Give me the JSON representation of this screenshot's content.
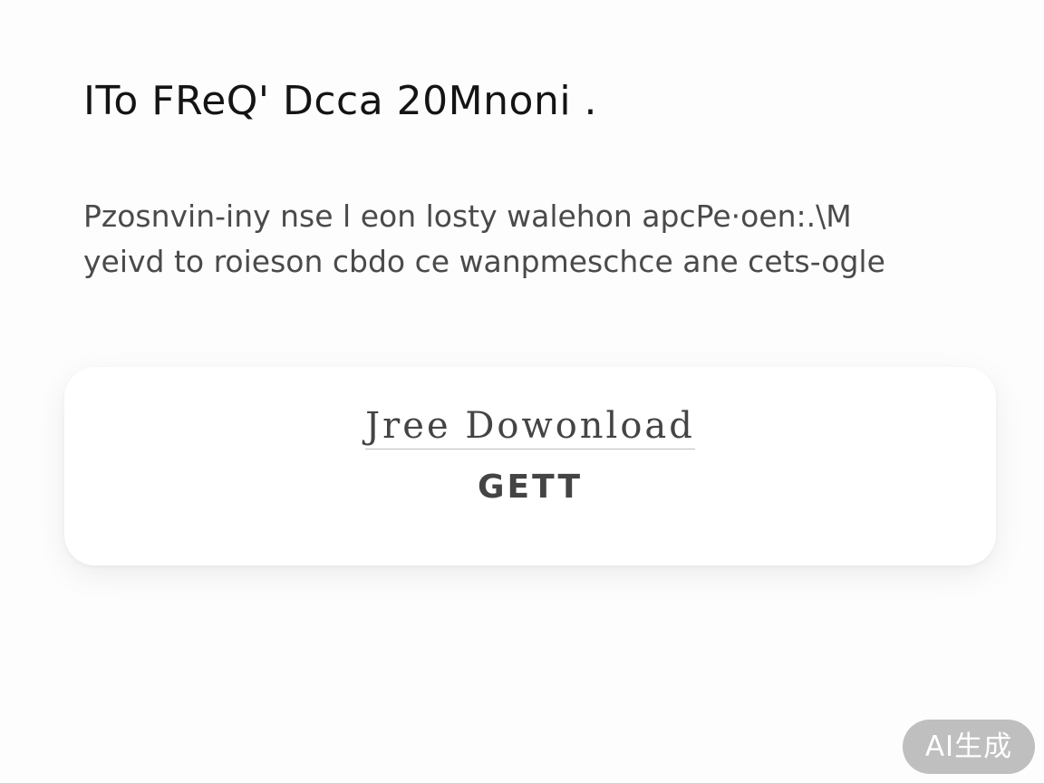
{
  "page": {
    "title": "ITo FReQ' Dcca 20Mnoni .",
    "description_lines": [
      "Pzosnvin-iny nse l eon losty walehon apcPe·oen:.\\M",
      "yeivd to roieson cbdo ce wanpmeschce ane cets-ogle"
    ]
  },
  "card": {
    "download_label": "Jree Dowonload",
    "get_label": "GETT"
  },
  "badge": {
    "label": "AI生成"
  }
}
